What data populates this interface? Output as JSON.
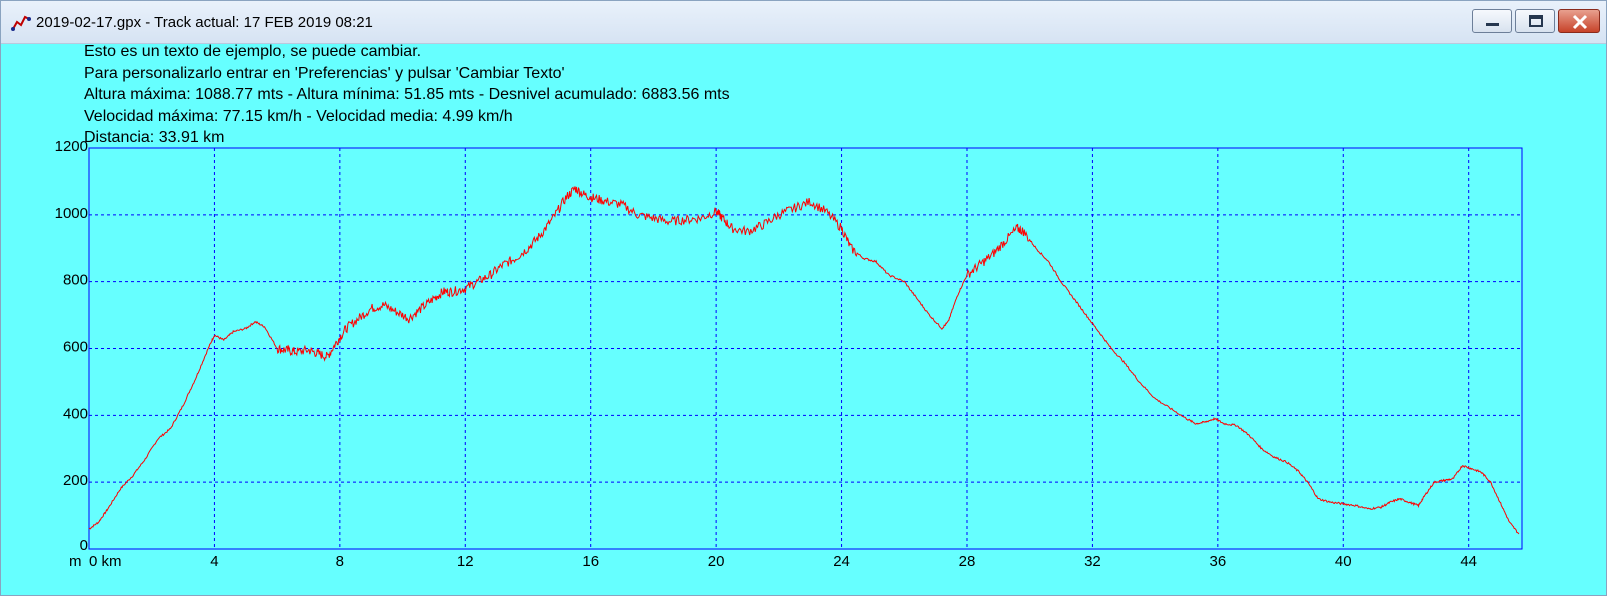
{
  "window": {
    "title": "2019-02-17.gpx - Track actual: 17 FEB 2019 08:21",
    "buttons": {
      "minimize": "minimize",
      "maximize": "maximize",
      "close": "close"
    }
  },
  "info": {
    "line1": "Esto es un texto de ejemplo, se puede cambiar.",
    "line2": "Para personalizarlo entrar en 'Preferencias' y pulsar 'Cambiar Texto'",
    "line3": "Altura máxima: 1088.77 mts - Altura mínima: 51.85 mts - Desnivel acumulado: 6883.56 mts",
    "line4": "Velocidad máxima: 77.15 km/h - Velocidad media: 4.99 km/h",
    "line5": "Distancia: 33.91 km"
  },
  "colors": {
    "background": "#66ffff",
    "axis": "#0000ff",
    "grid": "#0000ff",
    "profile": "#ff0000",
    "text": "#000000"
  },
  "chart_data": {
    "type": "line",
    "x_unit": "km",
    "y_unit": "m",
    "xlim": [
      0,
      45.7
    ],
    "ylim": [
      0,
      1200
    ],
    "x_ticks": [
      0,
      4,
      8,
      12,
      16,
      20,
      24,
      28,
      32,
      36,
      40,
      44
    ],
    "x_tick_labels": [
      "0 km",
      "4",
      "8",
      "12",
      "16",
      "20",
      "24",
      "28",
      "32",
      "36",
      "40",
      "44"
    ],
    "y_ticks": [
      0,
      200,
      400,
      600,
      800,
      1000,
      1200
    ],
    "y_tick_labels": [
      "0",
      "200",
      "400",
      "600",
      "800",
      "1000",
      "1200"
    ],
    "y_axis_label": "m",
    "grid": true,
    "series": [
      {
        "x": [
          0,
          0.3,
          0.6,
          1.0,
          1.4,
          1.8,
          2.2,
          2.6,
          3.0,
          3.4,
          3.8,
          4.0,
          4.3,
          4.6,
          5.0,
          5.3,
          5.6,
          6.0,
          6.3,
          6.6,
          7.0,
          7.3,
          7.6,
          7.9,
          8.2,
          8.6,
          9.0,
          9.4,
          9.8,
          10.2,
          10.6,
          11.0,
          11.3,
          11.6,
          12.0,
          12.4,
          12.8,
          13.2,
          13.6,
          14.0,
          14.4,
          14.8,
          15.2,
          15.5,
          15.8,
          16.1,
          16.5,
          17.0,
          17.5,
          18.0,
          18.5,
          19.0,
          19.5,
          20.0,
          20.2,
          20.5,
          21.0,
          21.5,
          22.0,
          22.5,
          23.0,
          23.5,
          24.0,
          24.3,
          24.7,
          25.1,
          25.5,
          26.0,
          26.4,
          26.8,
          27.2,
          27.4,
          27.7,
          28.0,
          28.4,
          28.8,
          29.2,
          29.6,
          29.8,
          30.2,
          30.6,
          31.0,
          31.4,
          31.8,
          32.2,
          32.6,
          33.0,
          33.5,
          34.0,
          34.5,
          35.0,
          35.3,
          35.6,
          35.9,
          36.2,
          36.6,
          37.0,
          37.4,
          37.8,
          38.2,
          38.6,
          38.9,
          39.2,
          39.6,
          40.0,
          40.4,
          40.8,
          41.2,
          41.5,
          41.8,
          42.1,
          42.4,
          42.6,
          42.9,
          43.2,
          43.5,
          43.8,
          44.1,
          44.4,
          44.7,
          45.0,
          45.3,
          45.6
        ],
        "y": [
          60,
          80,
          120,
          180,
          220,
          270,
          330,
          360,
          430,
          510,
          600,
          640,
          625,
          650,
          660,
          680,
          665,
          600,
          595,
          590,
          595,
          585,
          575,
          620,
          660,
          690,
          720,
          730,
          710,
          690,
          720,
          750,
          770,
          770,
          780,
          800,
          820,
          850,
          870,
          900,
          940,
          990,
          1050,
          1080,
          1060,
          1050,
          1040,
          1030,
          1000,
          990,
          980,
          985,
          990,
          1010,
          990,
          960,
          950,
          970,
          1000,
          1020,
          1040,
          1010,
          960,
          900,
          870,
          860,
          820,
          800,
          750,
          700,
          660,
          680,
          760,
          820,
          850,
          880,
          920,
          960,
          950,
          900,
          860,
          800,
          750,
          700,
          650,
          600,
          560,
          500,
          450,
          420,
          390,
          375,
          380,
          390,
          375,
          370,
          340,
          300,
          275,
          260,
          230,
          195,
          150,
          140,
          135,
          130,
          120,
          125,
          140,
          150,
          140,
          130,
          160,
          200,
          205,
          210,
          250,
          240,
          230,
          200,
          140,
          80,
          45
        ]
      }
    ]
  }
}
